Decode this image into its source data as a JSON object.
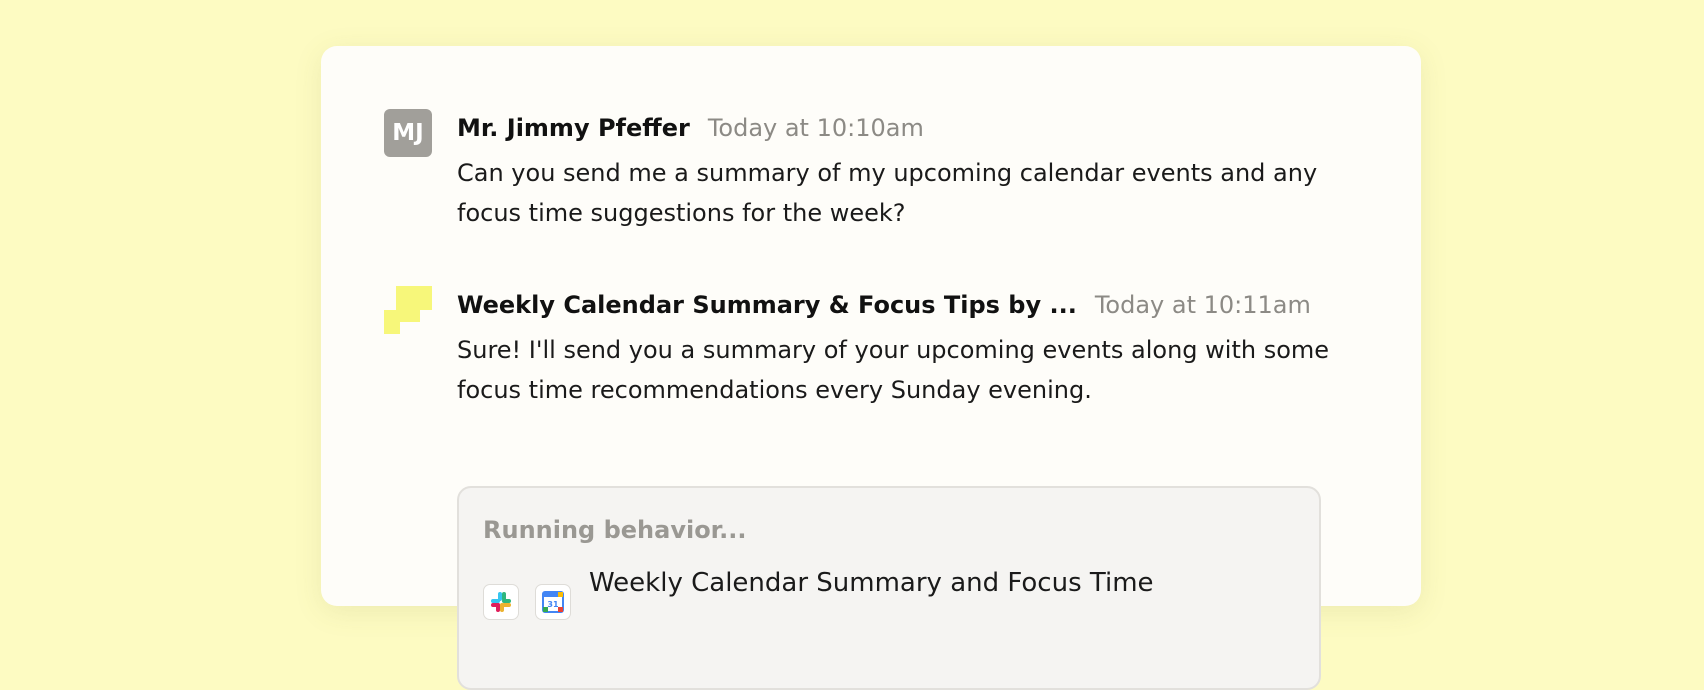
{
  "conversation": {
    "messages": [
      {
        "avatar_initials": "MJ",
        "author": "Mr. Jimmy Pfeffer",
        "timestamp": "Today at 10:10am",
        "text": "Can you send me a summary of my upcoming calendar events and any focus time suggestions for the week?"
      },
      {
        "avatar_icon": "bot-logo-icon",
        "author": "Weekly Calendar Summary & Focus Tips by ...",
        "timestamp": "Today at 10:11am",
        "text": "Sure! I'll send you a summary of your upcoming events along with some focus time recommendations every Sunday evening."
      }
    ],
    "behavior": {
      "status": "Running behavior...",
      "apps": [
        "slack-icon",
        "google-calendar-icon"
      ],
      "calendar_day": "31",
      "name": "Weekly Calendar Summary and Focus Time"
    }
  },
  "colors": {
    "background": "#fdfbc2",
    "card": "#fefdf9",
    "avatar_gray": "#a19f9a",
    "bot_yellow": "#f7f77a",
    "timestamp_gray": "#8c8a85"
  }
}
